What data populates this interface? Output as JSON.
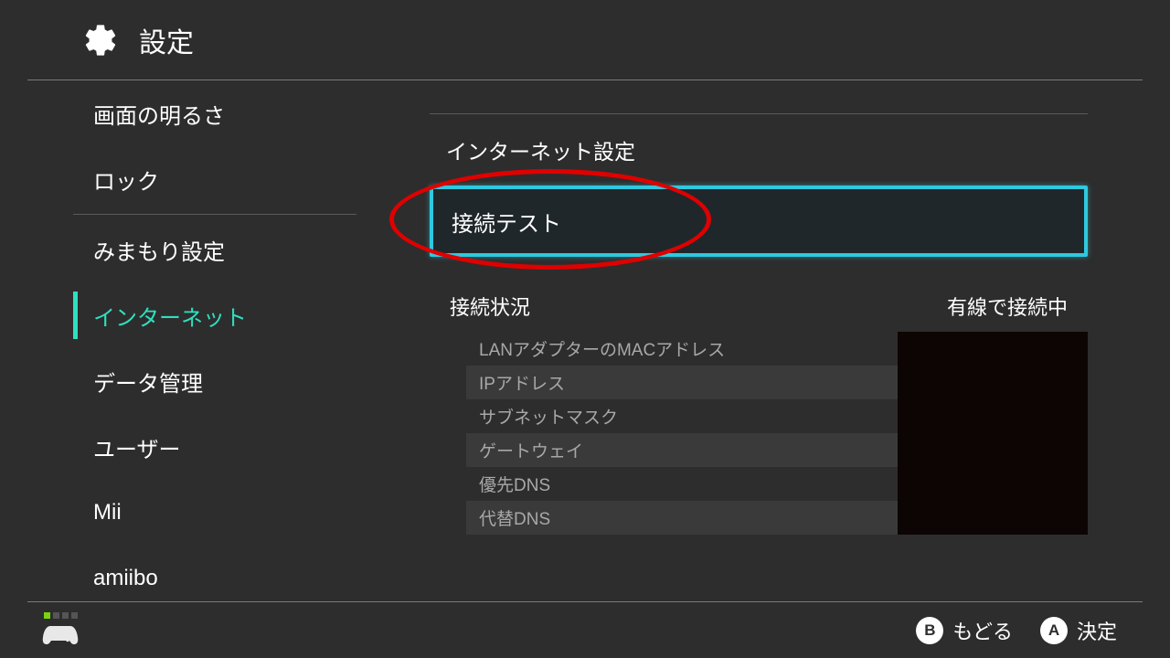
{
  "header": {
    "title": "設定"
  },
  "sidebar": {
    "items": [
      {
        "label": "画面の明るさ"
      },
      {
        "label": "ロック"
      },
      {
        "label": "みまもり設定"
      },
      {
        "label": "インターネット",
        "active": true
      },
      {
        "label": "データ管理"
      },
      {
        "label": "ユーザー"
      },
      {
        "label": "Mii"
      },
      {
        "label": "amiibo"
      }
    ]
  },
  "main": {
    "section_title": "インターネット設定",
    "connection_test": "接続テスト",
    "status_label": "接続状況",
    "status_value": "有線で接続中",
    "details": [
      {
        "label": "LANアダプターのMACアドレス"
      },
      {
        "label": "IPアドレス"
      },
      {
        "label": "サブネットマスク"
      },
      {
        "label": "ゲートウェイ"
      },
      {
        "label": "優先DNS"
      },
      {
        "label": "代替DNS"
      }
    ]
  },
  "footer": {
    "back_key": "B",
    "back_label": "もどる",
    "ok_key": "A",
    "ok_label": "決定"
  }
}
